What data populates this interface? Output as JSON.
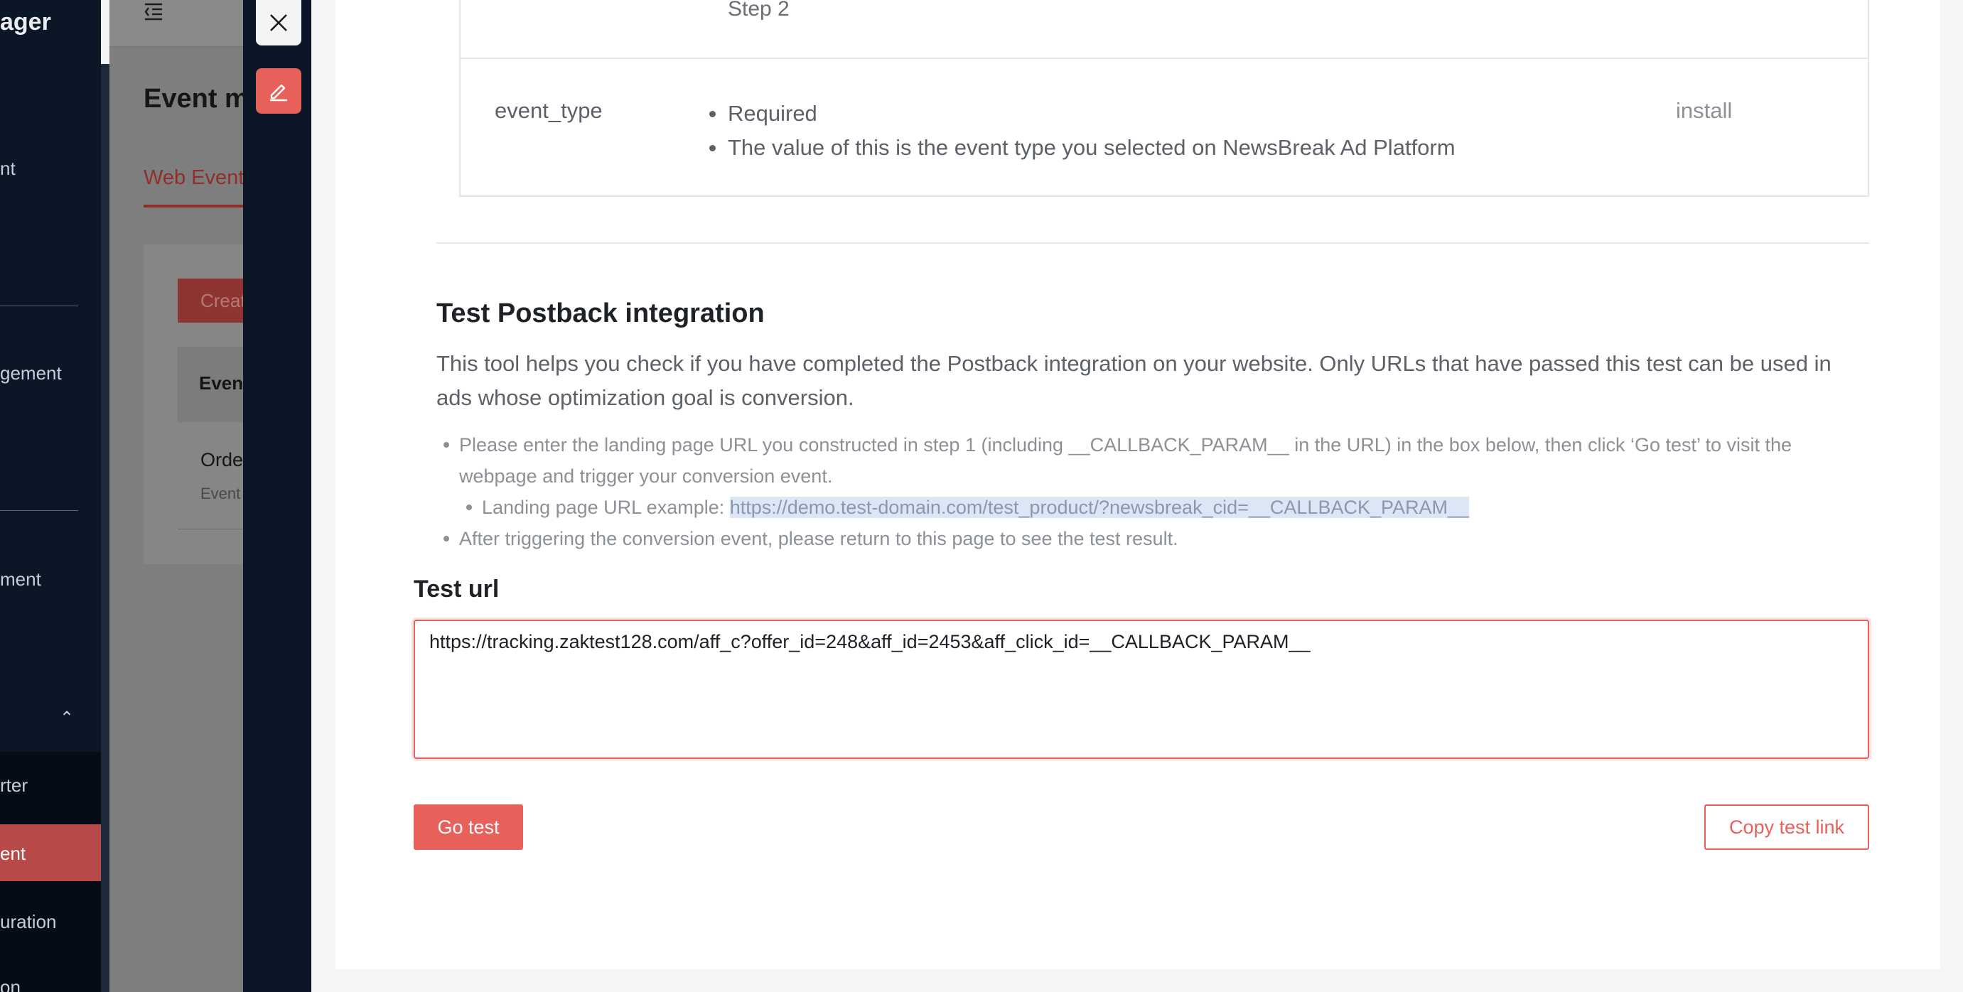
{
  "sidebar": {
    "brand": "ager",
    "items": [
      {
        "label": "nt"
      },
      {
        "label": "gement"
      },
      {
        "label": "ment"
      },
      {
        "label": "rter"
      },
      {
        "label": "ent"
      },
      {
        "label": "uration"
      },
      {
        "label": "on"
      }
    ],
    "active_index": 4
  },
  "background_page": {
    "title": "Event m",
    "tab": "Web Event",
    "create_button": "Creat",
    "table_header": "Event",
    "row_name": "Orde",
    "row_sub": "Event"
  },
  "param_table": {
    "step_text": "Step 2",
    "row": {
      "name": "event_type",
      "notes": [
        "Required",
        "The value of this is the event type you selected on NewsBreak Ad Platform"
      ],
      "example": "install"
    }
  },
  "test_section": {
    "title": "Test Postback integration",
    "description": "This tool helps you check if you have completed the Postback integration on your website. Only URLs that have passed this test can be used in ads whose optimization goal is conversion.",
    "instruction_1": "Please enter the landing page URL you constructed in step 1 (including __CALLBACK_PARAM__ in the URL) in the box below, then click ‘Go test’ to visit the webpage and trigger your conversion event.",
    "example_prefix": "Landing page URL example: ",
    "example_url": "https://demo.test-domain.com/test_product/?newsbreak_cid=__CALLBACK_PARAM__",
    "instruction_2": "After triggering the conversion event, please return to this page to see the test result.",
    "url_label": "Test url",
    "url_value": "https://tracking.zaktest128.com/aff_c?offer_id=248&aff_id=2453&aff_click_id=__CALLBACK_PARAM__",
    "go_button": "Go test",
    "copy_button": "Copy test link"
  },
  "colors": {
    "accent": "#e8605a",
    "sidebar_bg": "#0b1626",
    "active_item": "#b74a48"
  },
  "icons": {
    "close": "close-icon",
    "edit": "edit-icon",
    "menu": "menu-fold-icon",
    "chevron": "chevron-up-icon"
  }
}
